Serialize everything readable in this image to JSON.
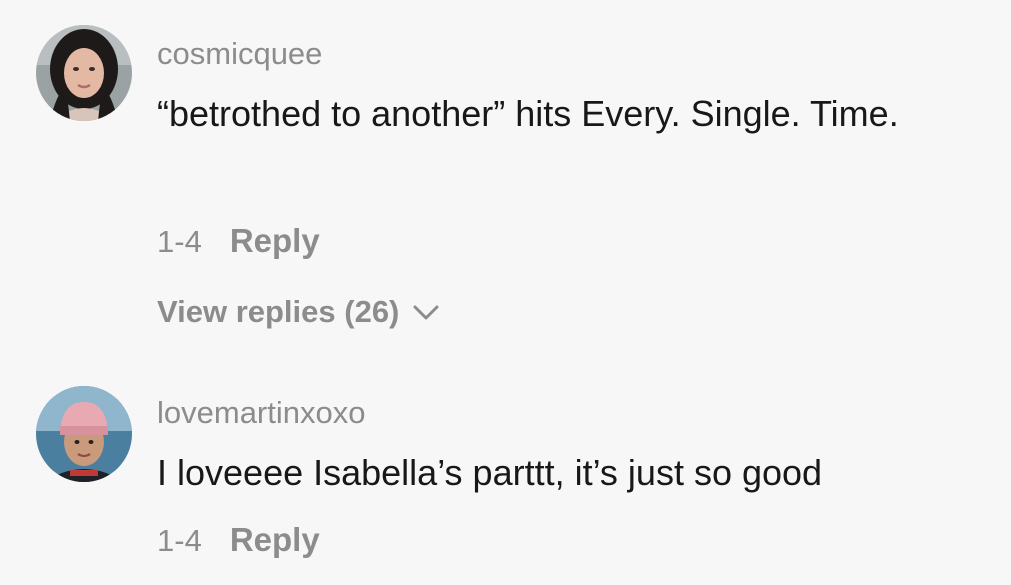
{
  "comments": [
    {
      "username": "cosmicquee",
      "text": "“betrothed to another” hits Every. Single. Time.",
      "date": "1-4",
      "reply_label": "Reply",
      "view_replies_label": "View replies (26)",
      "avatar_icon": "avatar-woman-dark-hair"
    },
    {
      "username": "lovemartinxoxo",
      "text": "I loveeee Isabella’s parttt, it’s just so good",
      "date": "1-4",
      "reply_label": "Reply",
      "avatar_icon": "avatar-person-pink-beanie"
    }
  ],
  "colors": {
    "background": "#f7f7f7",
    "text_primary": "#181818",
    "text_secondary": "#8c8c8c"
  }
}
